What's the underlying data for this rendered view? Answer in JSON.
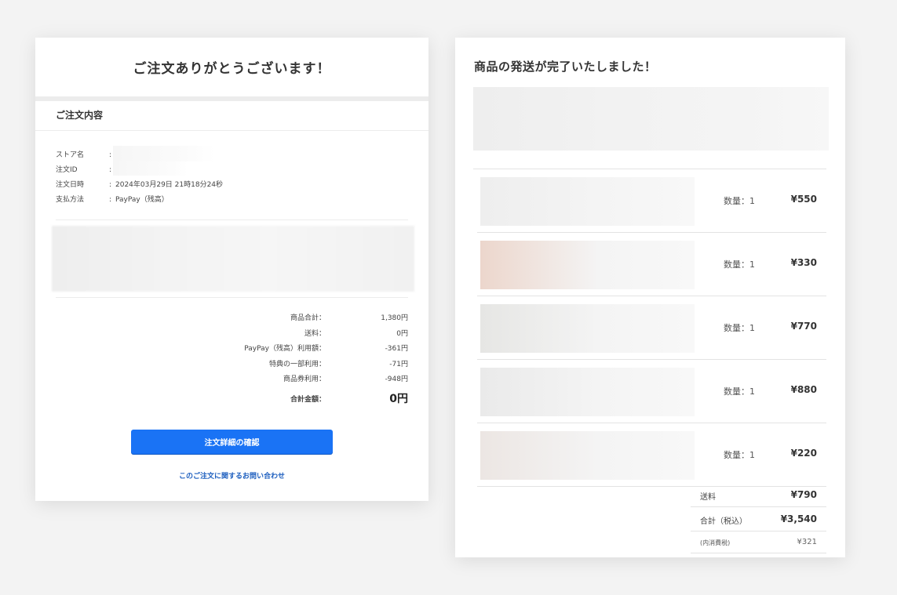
{
  "order_card": {
    "title": "ご注文ありがとうございます！",
    "section_title": "ご注文内容",
    "info": [
      {
        "label": "ストア名",
        "value": ""
      },
      {
        "label": "注文ID",
        "value": ""
      },
      {
        "label": "注文日時",
        "value": "2024年03月29日 21時18分24秒"
      },
      {
        "label": "支払方法",
        "value": "PayPay（残高）"
      }
    ],
    "totals": [
      {
        "label": "商品合計：",
        "value": "1,380円"
      },
      {
        "label": "送料：",
        "value": "0円"
      },
      {
        "label": "PayPay（残高）利用額：",
        "value": "-361円"
      },
      {
        "label": "特典の一部利用：",
        "value": "-71円"
      },
      {
        "label": "商品券利用：",
        "value": "-948円"
      }
    ],
    "grand_total": {
      "label": "合計金額：",
      "value": "0円"
    },
    "button_label": "注文詳細の確認",
    "inquiry_link": "このご注文に関するお問い合わせ",
    "accent_color": "#1a73f5"
  },
  "ship_card": {
    "title": "商品の発送が完了いたしました！",
    "items": [
      {
        "qty": "数量：1",
        "price": "¥550",
        "thumb_color": "#eeeeee"
      },
      {
        "qty": "数量：1",
        "price": "¥330",
        "thumb_color": "#ecd6cc"
      },
      {
        "qty": "数量：1",
        "price": "¥770",
        "thumb_color": "#e6e6e4"
      },
      {
        "qty": "数量：1",
        "price": "¥880",
        "thumb_color": "#eaeaea"
      },
      {
        "qty": "数量：1",
        "price": "¥220",
        "thumb_color": "#ece6e3"
      }
    ],
    "shipping": {
      "label": "送料",
      "value": "¥790"
    },
    "total": {
      "label": "合計（税込）",
      "value": "¥3,540"
    },
    "tax": {
      "label": "(内消費税)",
      "value": "¥321"
    }
  }
}
